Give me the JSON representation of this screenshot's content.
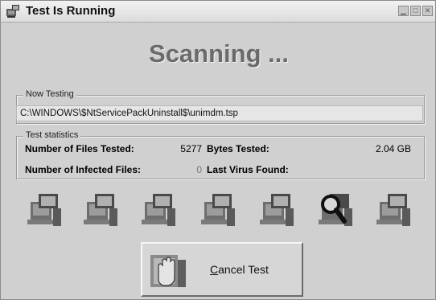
{
  "window": {
    "title": "Test Is Running",
    "controls": [
      "minimize",
      "maximize",
      "close"
    ]
  },
  "heading": "Scanning ...",
  "now_testing": {
    "legend": "Now Testing",
    "path": "C:\\WINDOWS\\$NtServicePackUninstall$\\unimdm.tsp"
  },
  "stats": {
    "legend": "Test statistics",
    "files_tested_label": "Number of Files Tested:",
    "files_tested_value": "5277",
    "bytes_tested_label": "Bytes Tested:",
    "bytes_tested_value": "2.04 GB",
    "infected_label": "Number of Infected Files:",
    "infected_value": "0",
    "last_virus_label": "Last Virus Found:",
    "last_virus_value": ""
  },
  "computer_icons": [
    {
      "icon": "computer-icon"
    },
    {
      "icon": "computer-icon"
    },
    {
      "icon": "computer-icon"
    },
    {
      "icon": "computer-icon"
    },
    {
      "icon": "computer-icon"
    },
    {
      "icon": "magnifier-icon"
    },
    {
      "icon": "computer-icon"
    }
  ],
  "cancel_button": {
    "label_underlined": "C",
    "label_rest": "ancel Test",
    "icon": "stop-hand-icon"
  }
}
